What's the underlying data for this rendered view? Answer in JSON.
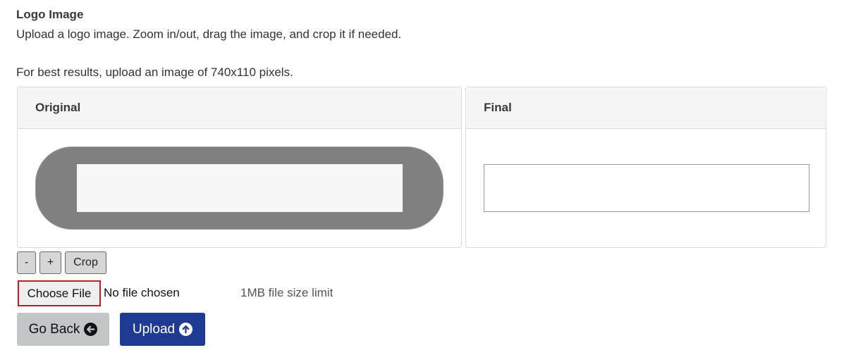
{
  "section": {
    "title": "Logo Image",
    "description": "Upload a logo image. Zoom in/out, drag the image, and crop it if needed.",
    "hint": "For best results, upload an image of 740x110 pixels."
  },
  "panels": {
    "original_title": "Original",
    "final_title": "Final"
  },
  "tools": {
    "zoom_out": "-",
    "zoom_in": "+",
    "crop": "Crop"
  },
  "file": {
    "choose_label": "Choose File",
    "status": "No file chosen",
    "size_limit": "1MB file size limit"
  },
  "actions": {
    "go_back": "Go Back",
    "upload": "Upload"
  },
  "icons": {
    "go_back": "arrow-left-circle-icon",
    "upload": "arrow-up-circle-icon"
  },
  "colors": {
    "upload_button": "#1f3a93",
    "go_back_button": "#c3c6c6",
    "choose_file_border": "#cc1a1a",
    "image_shape": "#808080"
  }
}
